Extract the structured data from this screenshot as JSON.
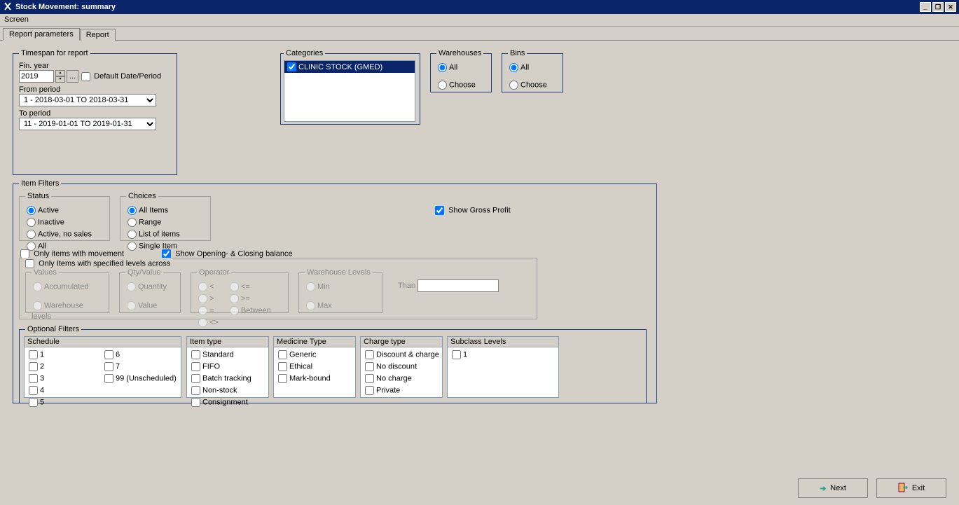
{
  "window": {
    "title": "Stock Movement: summary"
  },
  "menu": {
    "screen": "Screen"
  },
  "tabs": {
    "params": "Report parameters",
    "report": "Report"
  },
  "timespan": {
    "legend": "Timespan for report",
    "fin_year_label": "Fin. year",
    "fin_year": "2019",
    "default_date": "Default Date/Period",
    "from_label": "From period",
    "from_value": "1  - 2018-03-01 TO 2018-03-31",
    "to_label": "To period",
    "to_value": "11 - 2019-01-01 TO 2019-01-31"
  },
  "categories": {
    "legend": "Categories",
    "item1": "CLINIC STOCK  (GMED)"
  },
  "warehouses": {
    "legend": "Warehouses",
    "all": "All",
    "choose": "Choose"
  },
  "bins": {
    "legend": "Bins",
    "all": "All",
    "choose": "Choose"
  },
  "item_filters": {
    "legend": "Item Filters",
    "status_legend": "Status",
    "status": {
      "active": "Active",
      "inactive": "Inactive",
      "no_sales": "Active, no sales",
      "all": "All"
    },
    "choices_legend": "Choices",
    "choices": {
      "all": "All Items",
      "range": "Range",
      "list": "List of items",
      "single": "Single Item"
    },
    "show_gross": "Show Gross Profit",
    "only_movement": "Only items with movement",
    "show_opening": "Show Opening- & Closing balance",
    "only_levels": "Only Items with specified levels across",
    "values_legend": "Values",
    "values": {
      "acc": "Accumulated",
      "whl": "Warehouse levels"
    },
    "qtyval_legend": "Qty/Value",
    "qtyval": {
      "qty": "Quantity",
      "val": "Value"
    },
    "operator_legend": "Operator",
    "ops": {
      "lt": "<",
      "gt": ">",
      "eq": "=",
      "ne": "<>",
      "le": "<=",
      "ge": ">=",
      "bt": "Between"
    },
    "whl_legend": "Warehouse Levels",
    "whl": {
      "min": "Min",
      "max": "Max"
    },
    "than": "Than"
  },
  "optional": {
    "legend": "Optional Filters",
    "schedule_hdr": "Schedule",
    "schedule": {
      "s1": "1",
      "s2": "2",
      "s3": "3",
      "s4": "4",
      "s5": "5",
      "s6": "6",
      "s7": "7",
      "s99": "99 (Unscheduled)"
    },
    "itemtype_hdr": "Item type",
    "itemtype": {
      "std": "Standard",
      "fifo": "FIFO",
      "batch": "Batch tracking",
      "non": "Non-stock",
      "cons": "Consignment"
    },
    "medtype_hdr": "Medicine Type",
    "medtype": {
      "gen": "Generic",
      "eth": "Ethical",
      "mark": "Mark-bound"
    },
    "charge_hdr": "Charge type",
    "charge": {
      "dc": "Discount & charge",
      "nd": "No discount",
      "nc": "No charge",
      "pv": "Private"
    },
    "sub_hdr": "Subclass Levels",
    "sub": {
      "l1": "1"
    }
  },
  "buttons": {
    "next": "Next",
    "exit": "Exit"
  }
}
